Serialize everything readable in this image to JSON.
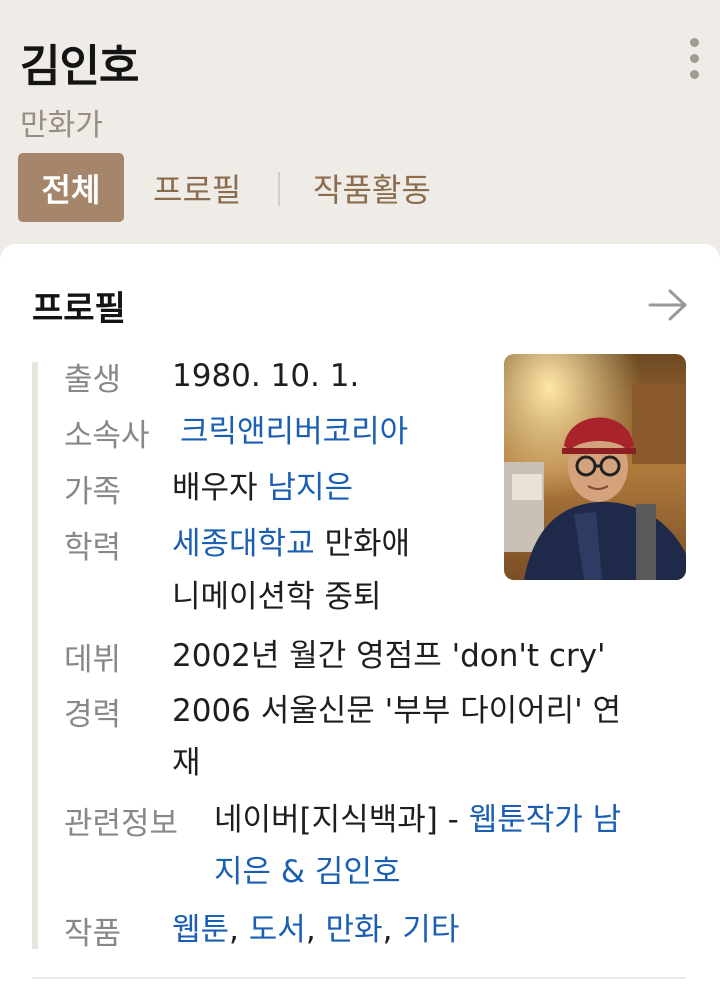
{
  "header": {
    "name": "김인호",
    "subtitle": "만화가",
    "tabs": [
      "전체",
      "프로필",
      "작품활동"
    ]
  },
  "profile": {
    "title": "프로필",
    "rows": {
      "birth": {
        "label": "출생",
        "value": "1980. 10. 1."
      },
      "agency": {
        "label": "소속사",
        "value": "크릭앤리버코리아"
      },
      "family": {
        "label": "가족",
        "prefix": "배우자",
        "link": "남지은"
      },
      "education": {
        "label": "학력",
        "link": "세종대학교",
        "line1_rest": "만화애",
        "line2": "니메이션학 중퇴"
      },
      "debut": {
        "label": "데뷔",
        "value": "2002년 월간 영점프 'don't cry'"
      },
      "career": {
        "label": "경력",
        "line1": "2006 서울신문 '부부 다이어리' 연",
        "line2": "재"
      },
      "related": {
        "label": "관련정보",
        "prefix": "네이버[지식백과] - ",
        "link_line1": "웹툰작가 남",
        "link_line2": "지은 & 김인호"
      },
      "works": {
        "label": "작품",
        "items": [
          "웹툰",
          "도서",
          "만화",
          "기타"
        ],
        "separator": ", "
      }
    }
  },
  "colors": {
    "accent": "#a5866a",
    "link": "#1a5fb4",
    "background": "#efebe6"
  }
}
